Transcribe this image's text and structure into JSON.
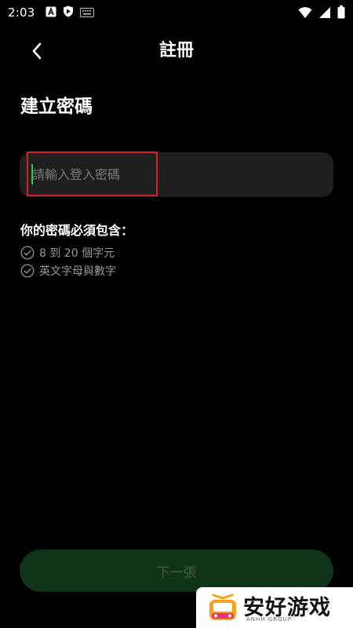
{
  "status_bar": {
    "time": "2:03",
    "icons": [
      "a-icon",
      "shield-icon",
      "keyboard-icon",
      "wifi-icon",
      "signal-icon",
      "battery-icon"
    ]
  },
  "header": {
    "title": "註冊",
    "back_icon": "chevron-left-icon"
  },
  "section_title": "建立密碼",
  "password_field": {
    "placeholder": "請輸入登入密碼",
    "value": ""
  },
  "requirements": {
    "title": "你的密碼必須包含：",
    "items": [
      "8 到 20 個字元",
      "英文字母與數字"
    ]
  },
  "next_button": {
    "label": "下一張"
  },
  "watermark": {
    "text": "安好游戏",
    "sub": "ANHH GROUP"
  },
  "colors": {
    "background": "#000000",
    "field_bg": "#1f1f1f",
    "button_bg": "#0f3417",
    "button_text": "#4a5a4c",
    "caret": "#33c24d",
    "highlight": "#d6202a"
  }
}
